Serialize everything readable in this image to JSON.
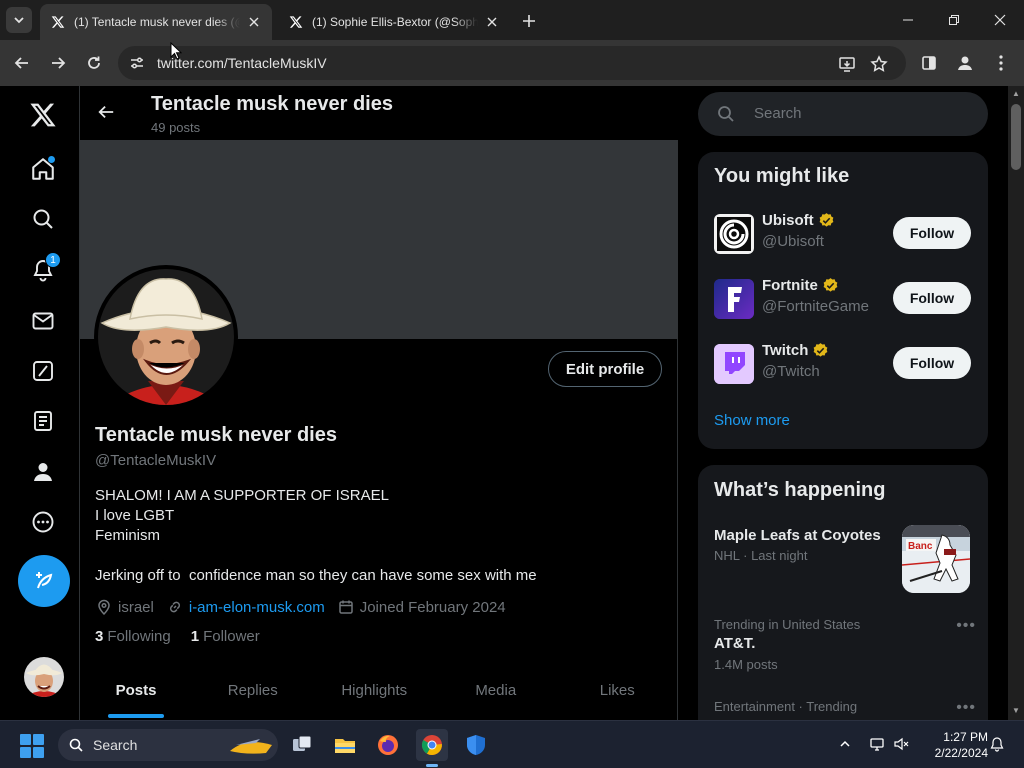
{
  "browser": {
    "tabs": [
      {
        "title": "(1) Tentacle musk never dies (@",
        "active": true
      },
      {
        "title": "(1) Sophie Ellis-Bextor (@Sophi",
        "active": false
      }
    ],
    "url": "twitter.com/TentacleMuskIV"
  },
  "nav": {
    "notifications_badge": "1"
  },
  "profile": {
    "header_name": "Tentacle musk never dies",
    "header_posts": "49 posts",
    "edit_profile": "Edit profile",
    "name": "Tentacle musk never dies",
    "handle": "@TentacleMuskIV",
    "bio": [
      "SHALOM! I AM A SUPPORTER OF ISRAEL",
      "I love LGBT",
      "Feminism",
      "",
      "Jerking off to  confidence man so they can have some sex with me"
    ],
    "location": "israel",
    "website": "i-am-elon-musk.com",
    "joined": "Joined February 2024",
    "following_count": "3",
    "following_label": "Following",
    "followers_count": "1",
    "followers_label": "Follower",
    "tabs": [
      "Posts",
      "Replies",
      "Highlights",
      "Media",
      "Likes"
    ]
  },
  "sidebar": {
    "search_placeholder": "Search",
    "you_might_like": {
      "title": "You might like",
      "accounts": [
        {
          "name": "Ubisoft",
          "handle": "@Ubisoft",
          "button": "Follow"
        },
        {
          "name": "Fortnite",
          "handle": "@FortniteGame",
          "button": "Follow"
        },
        {
          "name": "Twitch",
          "handle": "@Twitch",
          "button": "Follow"
        }
      ],
      "show_more": "Show more"
    },
    "whats_happening": {
      "title": "What’s happening",
      "trends": [
        {
          "title": "Maple Leafs at Coyotes",
          "meta": "NHL · Last night",
          "image_text": "Banc"
        },
        {
          "meta": "Trending in United States",
          "title": "AT&T.",
          "count": "1.4M posts"
        },
        {
          "meta": "Entertainment · Trending"
        }
      ]
    }
  },
  "taskbar": {
    "search_label": "Search",
    "time": "1:27 PM",
    "date": "2/22/2024"
  },
  "colors": {
    "accent": "#1d9bf0",
    "verified": "#e2b719",
    "background": "#000000"
  }
}
